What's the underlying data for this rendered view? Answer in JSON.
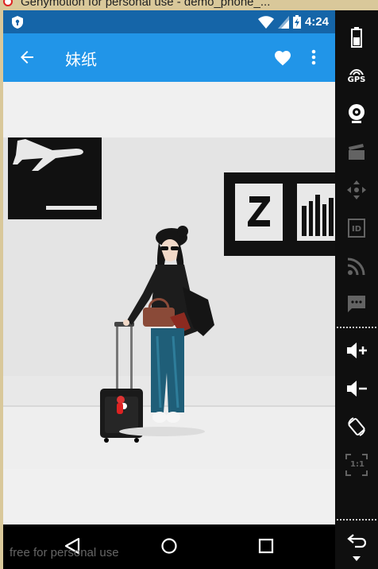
{
  "window": {
    "title": "Genymotion for personal use - demo_phone_..."
  },
  "status_bar": {
    "time": "4:24"
  },
  "app_bar": {
    "title": "妹纸"
  },
  "watermark": "free for personal use",
  "toolbar": {
    "gps_label": "GPS",
    "id_label": "ID",
    "scale_label": "1:1"
  }
}
